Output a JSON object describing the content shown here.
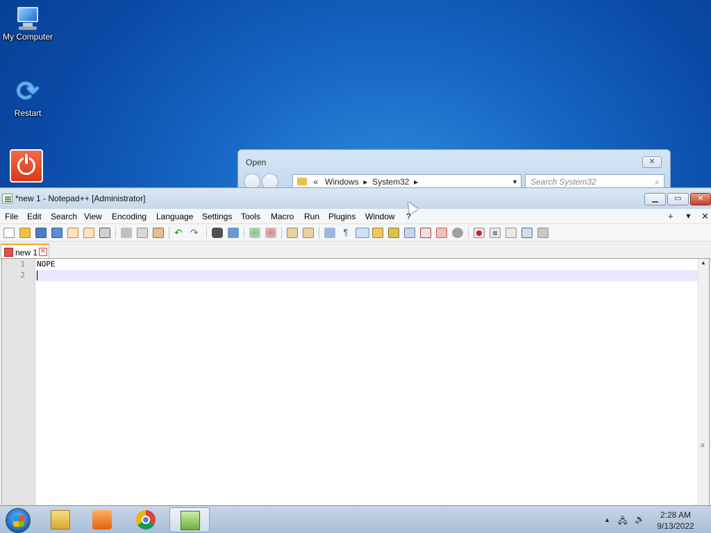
{
  "desktop": {
    "icons": [
      {
        "label": "My Computer"
      },
      {
        "label": "Restart"
      },
      {
        "label": ""
      }
    ]
  },
  "open_dialog": {
    "title": "Open",
    "breadcrumb": [
      "«",
      "Windows",
      "System32"
    ],
    "search_placeholder": "Search System32"
  },
  "notepadpp": {
    "title": "*new 1 - Notepad++ [Administrator]",
    "menu": [
      "File",
      "Edit",
      "Search",
      "View",
      "Encoding",
      "Language",
      "Settings",
      "Tools",
      "Macro",
      "Run",
      "Plugins",
      "Window",
      "?"
    ],
    "menu_right": [
      "+",
      "▼",
      "✕"
    ],
    "tab": {
      "label": "new 1",
      "modified": true
    },
    "editor": {
      "lines": [
        {
          "number": "1",
          "text": "NOPE"
        },
        {
          "number": "2",
          "text": ""
        }
      ],
      "current_line": 2
    },
    "toolbar_icons": [
      "new-file-icon",
      "open-file-icon",
      "save-icon",
      "save-all-icon",
      "close-icon",
      "close-all-icon",
      "print-icon",
      "cut-icon",
      "copy-icon",
      "paste-icon",
      "undo-icon",
      "redo-icon",
      "find-icon",
      "replace-icon",
      "zoom-in-icon",
      "zoom-out-icon",
      "sync-vertical-icon",
      "sync-horizontal-icon",
      "word-wrap-icon",
      "show-all-chars-icon",
      "indent-guide-icon",
      "udl-icon",
      "doc-map-icon",
      "doc-list-icon",
      "function-list-icon",
      "folder-workspace-icon",
      "monitoring-icon",
      "record-macro-icon",
      "stop-record-icon",
      "play-macro-icon",
      "run-macro-multiple-icon",
      "save-macro-icon"
    ]
  },
  "taskbar": {
    "apps": [
      "file-explorer",
      "media-player",
      "chrome",
      "notepadpp"
    ],
    "clock_time": "2:28 AM",
    "clock_date": "9/13/2022"
  },
  "colors": {
    "desktop_bg": "#1766c4",
    "tab_accent": "#f5a623",
    "current_line": "#e8e8ff",
    "close_btn": "#c4412a"
  }
}
